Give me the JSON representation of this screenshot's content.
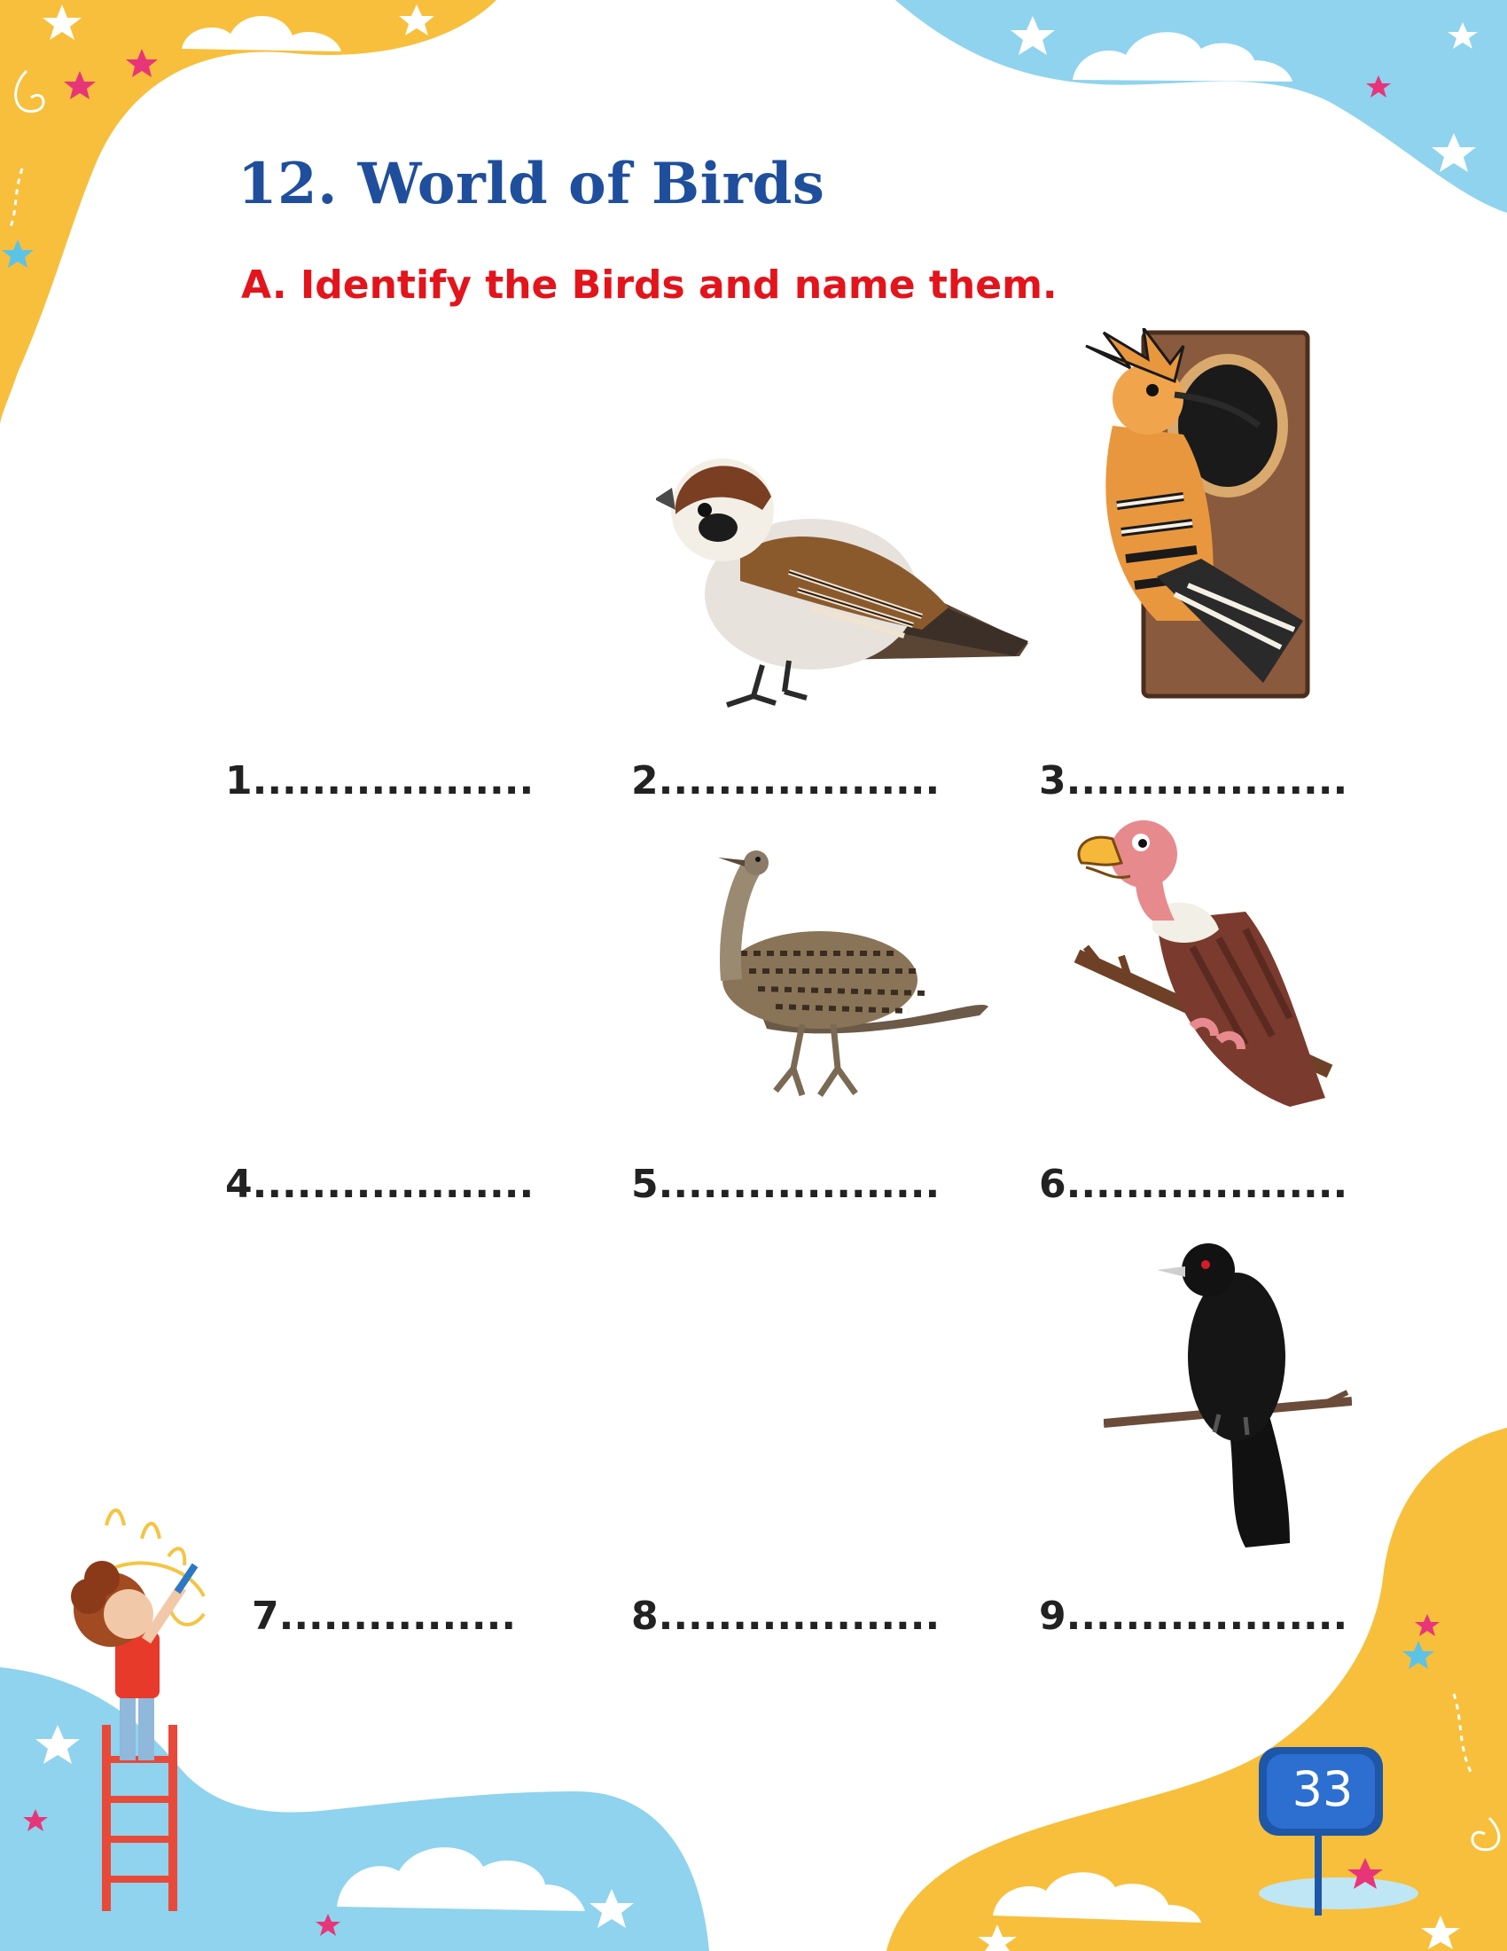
{
  "heading": {
    "title": "12. World of Birds",
    "instruction": "A. Identify the Birds and name them."
  },
  "answers": [
    {
      "num": "1",
      "blank": "1..................."
    },
    {
      "num": "2",
      "blank": "2..................."
    },
    {
      "num": "3",
      "blank": "3..................."
    },
    {
      "num": "4",
      "blank": "4..................."
    },
    {
      "num": "5",
      "blank": "5..................."
    },
    {
      "num": "6",
      "blank": "6..................."
    },
    {
      "num": "7",
      "blank": "7................"
    },
    {
      "num": "8",
      "blank": "8..................."
    },
    {
      "num": "9",
      "blank": "9..................."
    }
  ],
  "birds": [
    "sparrow",
    "hoopoe",
    "bustard",
    "vulture",
    "koel"
  ],
  "footer": {
    "page_number": "33"
  },
  "colors": {
    "title": "#1f4f9c",
    "instruction": "#e3141b",
    "yellow_wave": "#f7bf3b",
    "blue_wave": "#8fd3ee",
    "badge": "#1e56a8"
  }
}
